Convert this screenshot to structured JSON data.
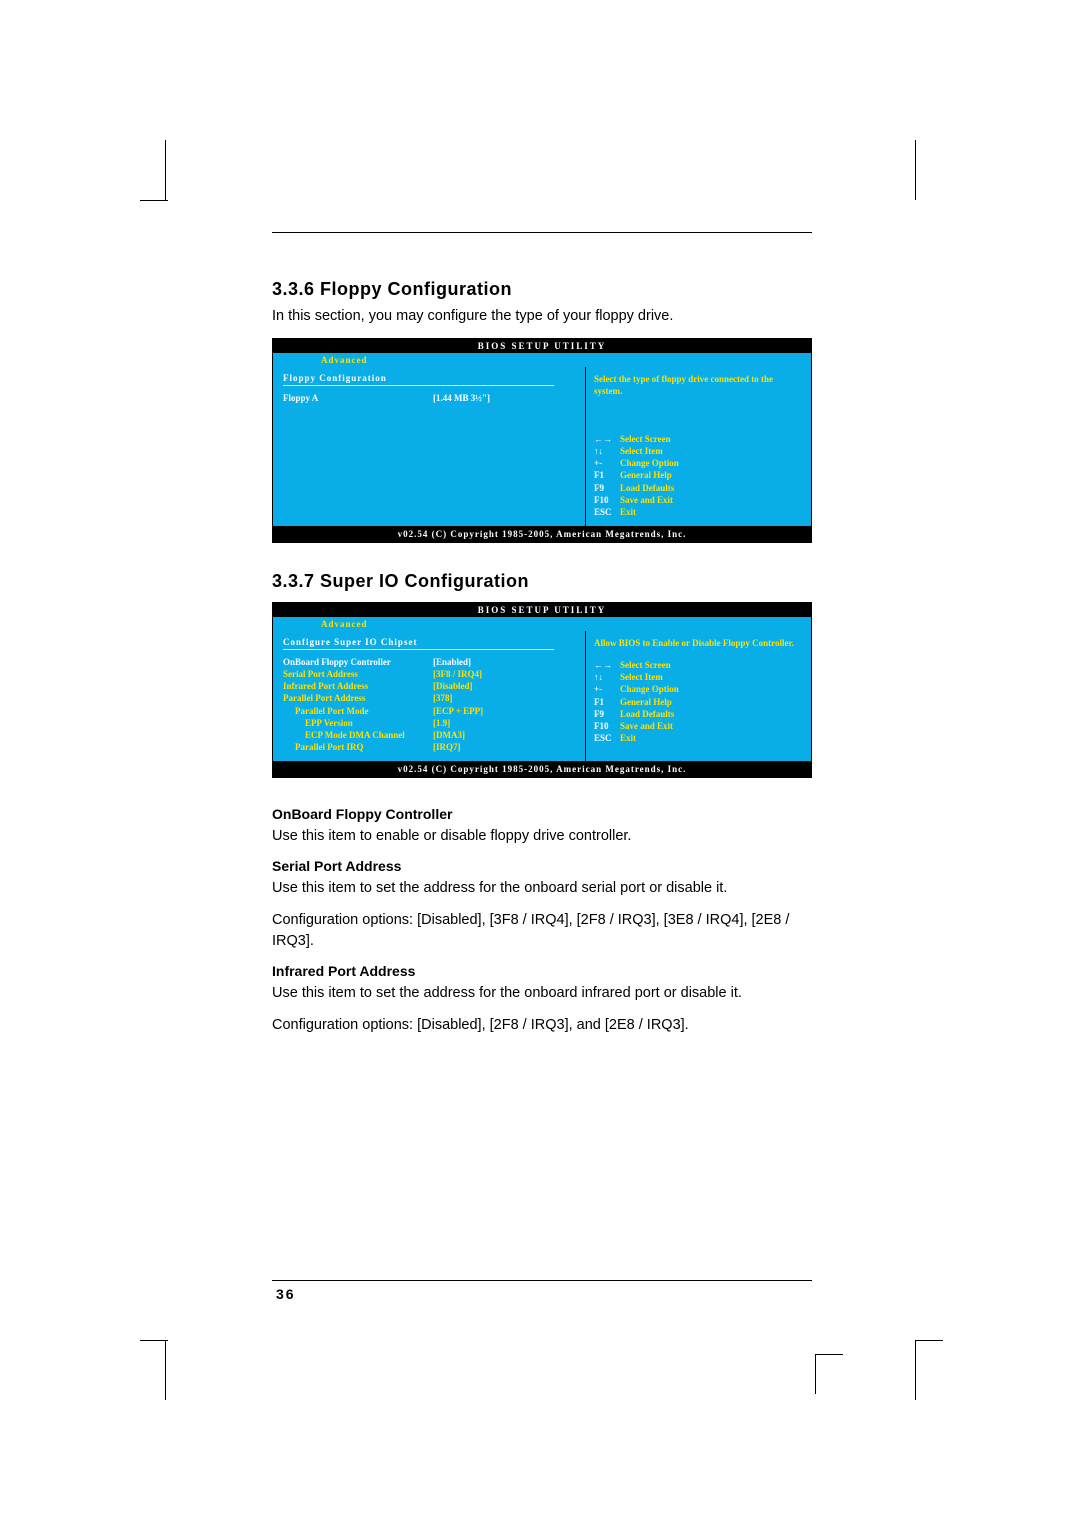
{
  "section1": {
    "heading": "3.3.6 Floppy Configuration",
    "intro": "In this section, you may configure the type of your floppy drive."
  },
  "section2": {
    "heading": "3.3.7 Super IO Configuration"
  },
  "bios_common": {
    "title": "BIOS  SETUP  UTILITY",
    "tab": "Advanced",
    "footer": "v02.54 (C) Copyright 1985-2005, American Megatrends, Inc.",
    "keys": [
      {
        "k": "←→",
        "t": "Select Screen"
      },
      {
        "k": "↑↓",
        "t": "Select Item"
      },
      {
        "k": "+-",
        "t": "Change Option"
      },
      {
        "k": "F1",
        "t": "General Help"
      },
      {
        "k": "F9",
        "t": "Load Defaults"
      },
      {
        "k": "F10",
        "t": "Save and Exit"
      },
      {
        "k": "ESC",
        "t": "Exit"
      }
    ]
  },
  "bios1": {
    "left_title": "Floppy Configuration",
    "rows": [
      {
        "label": "Floppy A",
        "value": "[1.44 MB  3½\"]",
        "selected": true
      }
    ],
    "help": "Select  the  type  of  floppy  drive  connected  to  the  system."
  },
  "bios2": {
    "left_title": "Configure  Super  IO  Chipset",
    "rows": [
      {
        "label": "OnBoard Floppy Controller",
        "value": "[Enabled]",
        "selected": true
      },
      {
        "label": "Serial Port Address",
        "value": "[3F8 / IRQ4]"
      },
      {
        "label": "Infrared Port Address",
        "value": "[Disabled]"
      },
      {
        "label": "Parallel Port Address",
        "value": "[378]"
      },
      {
        "label": "Parallel Port Mode",
        "value": "[ECP + EPP]",
        "indent": 1
      },
      {
        "label": "EPP Version",
        "value": "[1.9]",
        "indent": 2
      },
      {
        "label": "ECP Mode DMA Channel",
        "value": "[DMA3]",
        "indent": 2
      },
      {
        "label": "Parallel Port IRQ",
        "value": "[IRQ7]",
        "indent": 1
      }
    ],
    "help": "Allow  BIOS  to  Enable  or  Disable  Floppy  Controller."
  },
  "items": {
    "h1": "OnBoard Floppy Controller",
    "p1": "Use this item to enable or disable floppy drive controller.",
    "h2": "Serial Port Address",
    "p2a": "Use this item to set the address for the onboard serial port or disable it.",
    "p2b": "Configuration options: [Disabled], [3F8 / IRQ4], [2F8 / IRQ3], [3E8 / IRQ4], [2E8 / IRQ3].",
    "h3": "Infrared Port Address",
    "p3a": "Use this item to set the address for the onboard infrared port or disable it.",
    "p3b": "Configuration options: [Disabled], [2F8 / IRQ3], and [2E8 / IRQ3]."
  },
  "page_number": "36"
}
